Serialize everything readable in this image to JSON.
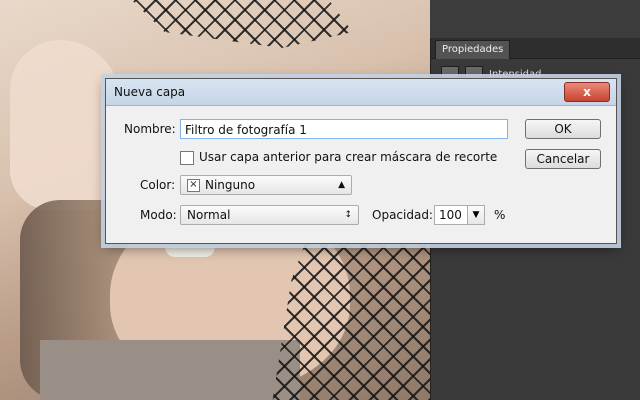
{
  "panel": {
    "tab": "Propiedades",
    "row_label": "Intensidad"
  },
  "dialog": {
    "title": "Nueva capa",
    "close": "x",
    "name_label": "Nombre:",
    "name_value": "Filtro de fotografía 1",
    "checkbox_label": "Usar capa anterior para crear máscara de recorte",
    "checkbox_checked": false,
    "color_label": "Color:",
    "color_value": "Ninguno",
    "color_swatch": "×",
    "mode_label": "Modo:",
    "mode_value": "Normal",
    "opacity_label": "Opacidad:",
    "opacity_value": "100",
    "opacity_unit": "%",
    "ok": "OK",
    "cancel": "Cancelar"
  }
}
